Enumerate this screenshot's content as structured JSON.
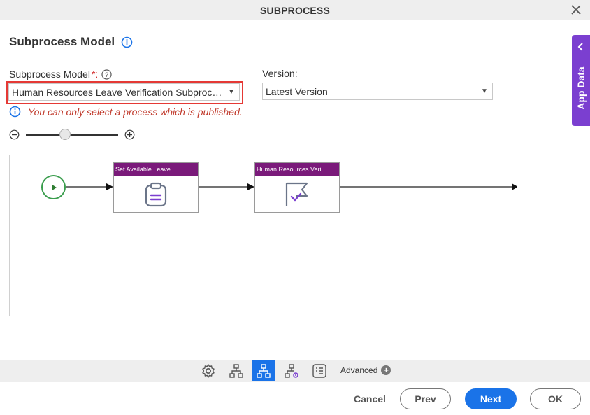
{
  "dialog": {
    "title": "SUBPROCESS"
  },
  "heading": "Subprocess Model",
  "form": {
    "subprocess_label": "Subprocess Model",
    "subprocess_required_mark": "*:",
    "subprocess_value": "Human Resources Leave Verification Subproce...",
    "version_label": "Version:",
    "version_value": "Latest Version",
    "note": "You can only select a process which is published."
  },
  "diagram": {
    "nodes": [
      {
        "title": "Set Available Leave ...",
        "icon": "clipboard-icon"
      },
      {
        "title": "Human Resources Veri...",
        "icon": "flag-check-icon"
      }
    ]
  },
  "side_panel": {
    "label": "App Data"
  },
  "toolbar": {
    "items": [
      "gear-icon",
      "process-tree-icon",
      "process-tree-icon",
      "process-tree-settings-icon",
      "list-icon"
    ],
    "active_index": 2,
    "advanced_label": "Advanced"
  },
  "footer": {
    "cancel": "Cancel",
    "prev": "Prev",
    "next": "Next",
    "ok": "OK"
  },
  "colors": {
    "primary": "#1a73e8",
    "app_data": "#7b3fd0",
    "node_header": "#7a1a7a",
    "start": "#3a9d4d",
    "error": "#c0392b"
  }
}
